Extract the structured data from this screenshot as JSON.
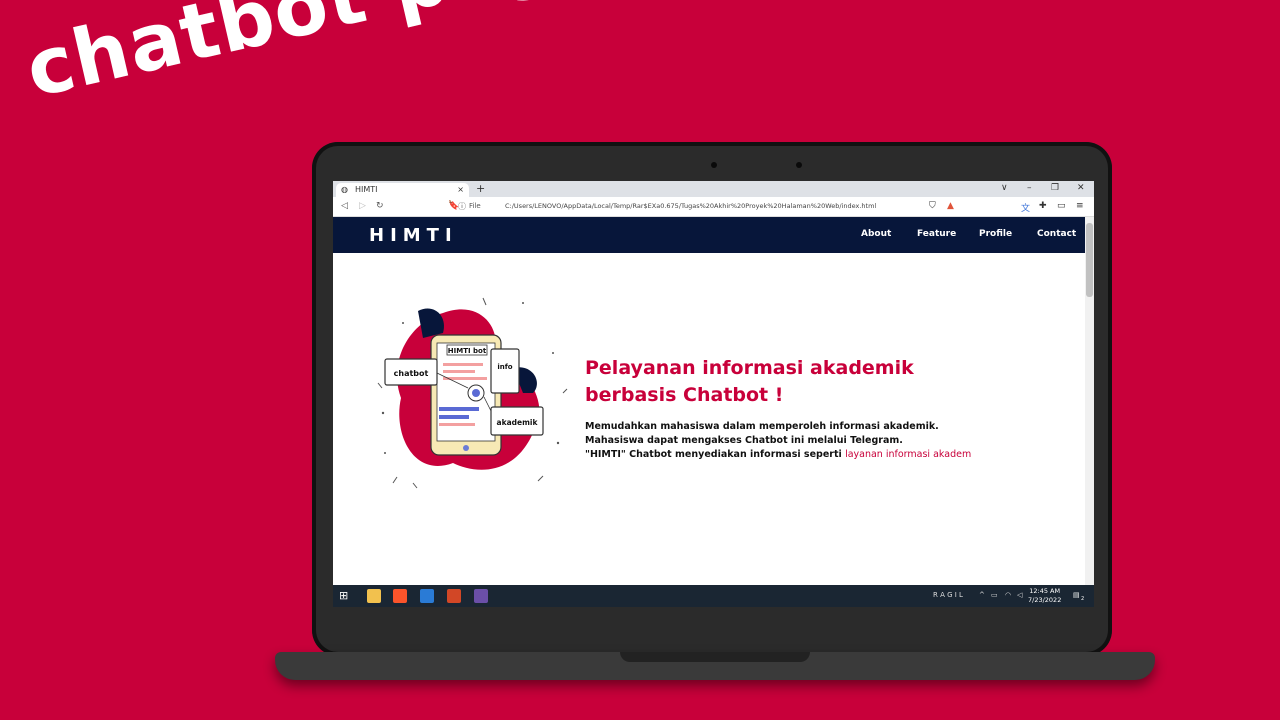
{
  "headline": "chatbot page",
  "browser": {
    "tab_title": "HIMTI",
    "tab_close": "×",
    "new_tab": "+",
    "url_scheme_label": "File",
    "url": "C:/Users/LENOVO/AppData/Local/Temp/Rar$EXa0.675/Tugas%20Akhir%20Proyek%20Halaman%20Web/index.html",
    "window_controls": [
      "∨",
      "–",
      "❐",
      "✕"
    ]
  },
  "site": {
    "logo": "HIMTI",
    "nav": [
      "About",
      "Feature",
      "Profile",
      "Contact"
    ],
    "heading_line1": "Pelayanan informasi akademik",
    "heading_line2": "berbasis Chatbot !",
    "desc_line1": "Memudahkan mahasiswa dalam memperoleh informasi akademik.",
    "desc_line2": "Mahasiswa dapat mengakses Chatbot ini melalui Telegram.",
    "desc_line3_prefix": "\"HIMTI\" Chatbot menyediakan informasi seperti ",
    "desc_line3_highlight": "layanan informasi akadem",
    "illustration": {
      "phone_title": "HIMTI bot",
      "card_chatbot": "chatbot",
      "card_info": "info",
      "card_akademik": "akademik"
    }
  },
  "taskbar": {
    "tray_text": "R A G I L",
    "time": "12:45 AM",
    "date": "7/23/2022",
    "notification_count": "2"
  },
  "colors": {
    "brand_red": "#c8003a",
    "nav_dark": "#07163a",
    "taskbar": "#1a2633"
  }
}
